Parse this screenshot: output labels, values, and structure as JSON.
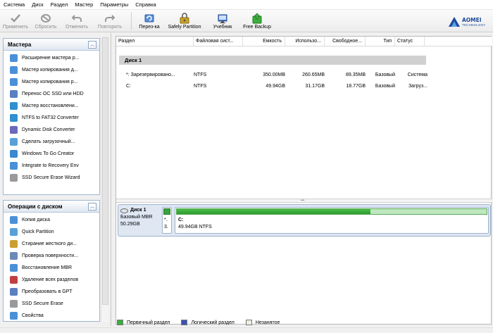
{
  "menubar": [
    "Система",
    "Диск",
    "Раздел",
    "Мастер",
    "Параметры",
    "Справка"
  ],
  "toolbar": {
    "buttons": [
      {
        "label": "Применить",
        "icon": "checkmark-icon",
        "enabled": false
      },
      {
        "label": "Сбросить",
        "icon": "discard-icon",
        "enabled": false
      },
      {
        "label": "Отменить",
        "icon": "undo-icon",
        "enabled": false
      },
      {
        "label": "Повторить",
        "icon": "redo-icon",
        "enabled": false
      },
      {
        "label": "Перез-ка",
        "icon": "reload-icon",
        "enabled": true
      },
      {
        "label": "Safely Partition",
        "icon": "safely-partition-icon",
        "enabled": true
      },
      {
        "label": "Учебник",
        "icon": "tutorial-icon",
        "enabled": true
      },
      {
        "label": "Free Backup",
        "icon": "backup-icon",
        "enabled": true
      }
    ],
    "logo": {
      "brand": "AOMEI",
      "sub": "TECHNOLOGY"
    }
  },
  "wizards_panel": {
    "title": "Мастера",
    "items": [
      "Расширение мастера р...",
      "Мастер копирования д...",
      "Мастер копирования р...",
      "Перенос ОС SSD или HDD",
      "Мастер восстановлени...",
      "NTFS to FAT32 Converter",
      "Dynamic Disk Converter",
      "Сделать загрузочный...",
      "Windows To Go Creator",
      "Integrate to Recovery Env",
      "SSD Secure Erase Wizard"
    ]
  },
  "disk_ops_panel": {
    "title": "Операции с диском",
    "items": [
      "Копия диска",
      "Quick Partition",
      "Стирание жесткого ди...",
      "Проверка поверхности...",
      "Восстановление MBR",
      "Удаление всех разделов",
      "Преобразовать в GPT",
      "SSD Secure Erase",
      "Свойства"
    ]
  },
  "table": {
    "headers": [
      "Раздел",
      "Файловая сист...",
      "Емкость",
      "Использо...",
      "Свободное...",
      "Тип",
      "Статус"
    ],
    "disk_label": "Диск 1",
    "rows": [
      [
        "*: Зарезервировано...",
        "NTFS",
        "350.00MB",
        "260.65MB",
        "89.35MB",
        "Базовый",
        "Система"
      ],
      [
        "C:",
        "NTFS",
        "49.94GB",
        "31.17GB",
        "18.77GB",
        "Базовый",
        "Загруз..."
      ]
    ]
  },
  "diskmap": {
    "name": "Диск 1",
    "type": "Базовый MBR",
    "size": "50.29GB",
    "small_part": {
      "line1": "*.",
      "line2": "3."
    },
    "c_part": {
      "label": "C:",
      "detail": "49.94GB NTFS",
      "used_fraction": 0.624
    }
  },
  "legend": [
    {
      "label": "Первичный раздел",
      "color": "#3cae3c"
    },
    {
      "label": "Логический раздел",
      "color": "#3a52b0"
    },
    {
      "label": "Незанятое",
      "color": "#f0ece0"
    }
  ]
}
